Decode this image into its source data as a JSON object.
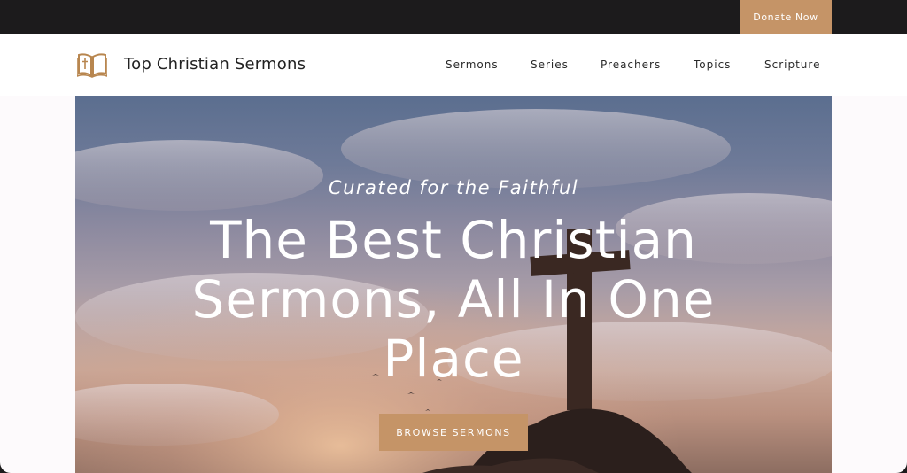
{
  "topbar": {
    "donate_label": "Donate Now"
  },
  "header": {
    "brand": "Top Christian Sermons",
    "logo_icon": "bible-cross-icon",
    "nav": [
      {
        "label": "Sermons"
      },
      {
        "label": "Series"
      },
      {
        "label": "Preachers"
      },
      {
        "label": "Topics"
      },
      {
        "label": "Scripture"
      }
    ]
  },
  "hero": {
    "kicker": "Curated for the Faithful",
    "headline": "The Best Christian Sermons, All In One Place",
    "cta_label": "BROWSE SERMONS",
    "background": "sunset-sky-with-cross-on-hill"
  },
  "colors": {
    "accent": "#c59467",
    "topbar": "#1c1b1c",
    "header": "#ffffff"
  }
}
